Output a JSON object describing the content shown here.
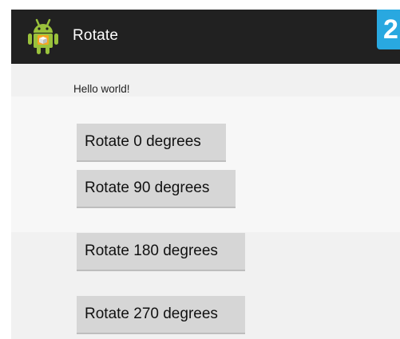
{
  "action_bar": {
    "title": "Rotate",
    "icon": "android-robot-icon"
  },
  "step_badge": "2",
  "content": {
    "hello_text": "Hello world!"
  },
  "buttons": [
    {
      "label": "Rotate 0 degrees"
    },
    {
      "label": "Rotate 90 degrees"
    },
    {
      "label": "Rotate 180 degrees"
    },
    {
      "label": "Rotate 270 degrees"
    }
  ],
  "colors": {
    "action_bar": "#212121",
    "badge": "#29a8e0",
    "icon_green": "#9ac23c",
    "button": "#d6d6d6"
  }
}
